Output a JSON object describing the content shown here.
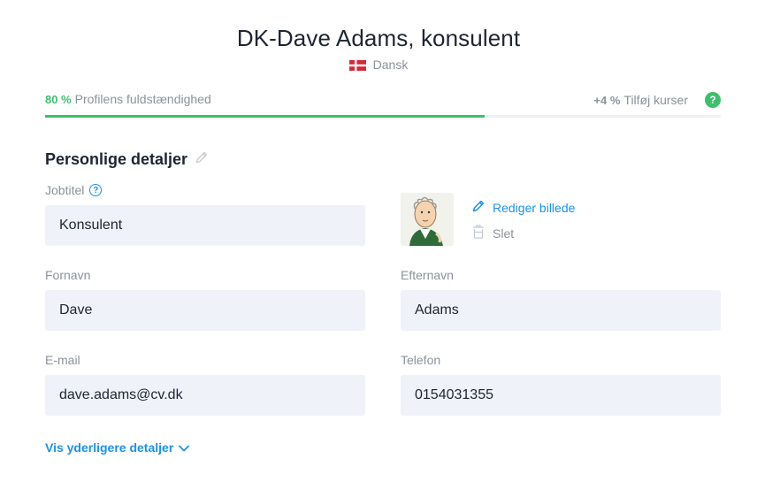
{
  "header": {
    "title": "DK-Dave Adams, konsulent",
    "language": "Dansk",
    "flag_icon": "denmark-flag-icon"
  },
  "progress": {
    "percent_label": "80 %",
    "label": "Profilens fuldstændighed",
    "fraction": 0.8,
    "bonus_label": "+4 %",
    "bonus_action": "Tilføj kurser",
    "help_icon": "question-circle-icon"
  },
  "section": {
    "title": "Personlige detaljer",
    "edit_icon": "pencil-icon"
  },
  "fields": {
    "jobtitle": {
      "label": "Jobtitel",
      "value": "Konsulent"
    },
    "firstname": {
      "label": "Fornavn",
      "value": "Dave"
    },
    "lastname": {
      "label": "Efternavn",
      "value": "Adams"
    },
    "email": {
      "label": "E-mail",
      "value": "dave.adams@cv.dk"
    },
    "phone": {
      "label": "Telefon",
      "value": "0154031355"
    }
  },
  "photo": {
    "edit_label": "Rediger billede",
    "delete_label": "Slet"
  },
  "more_details": {
    "label": "Vis yderligere detaljer",
    "icon": "chevron-down-icon"
  },
  "colors": {
    "accent_green": "#3dbf6b",
    "link_blue": "#1a91f0",
    "field_bg": "#eff2f9",
    "muted_text": "#8b929b"
  }
}
